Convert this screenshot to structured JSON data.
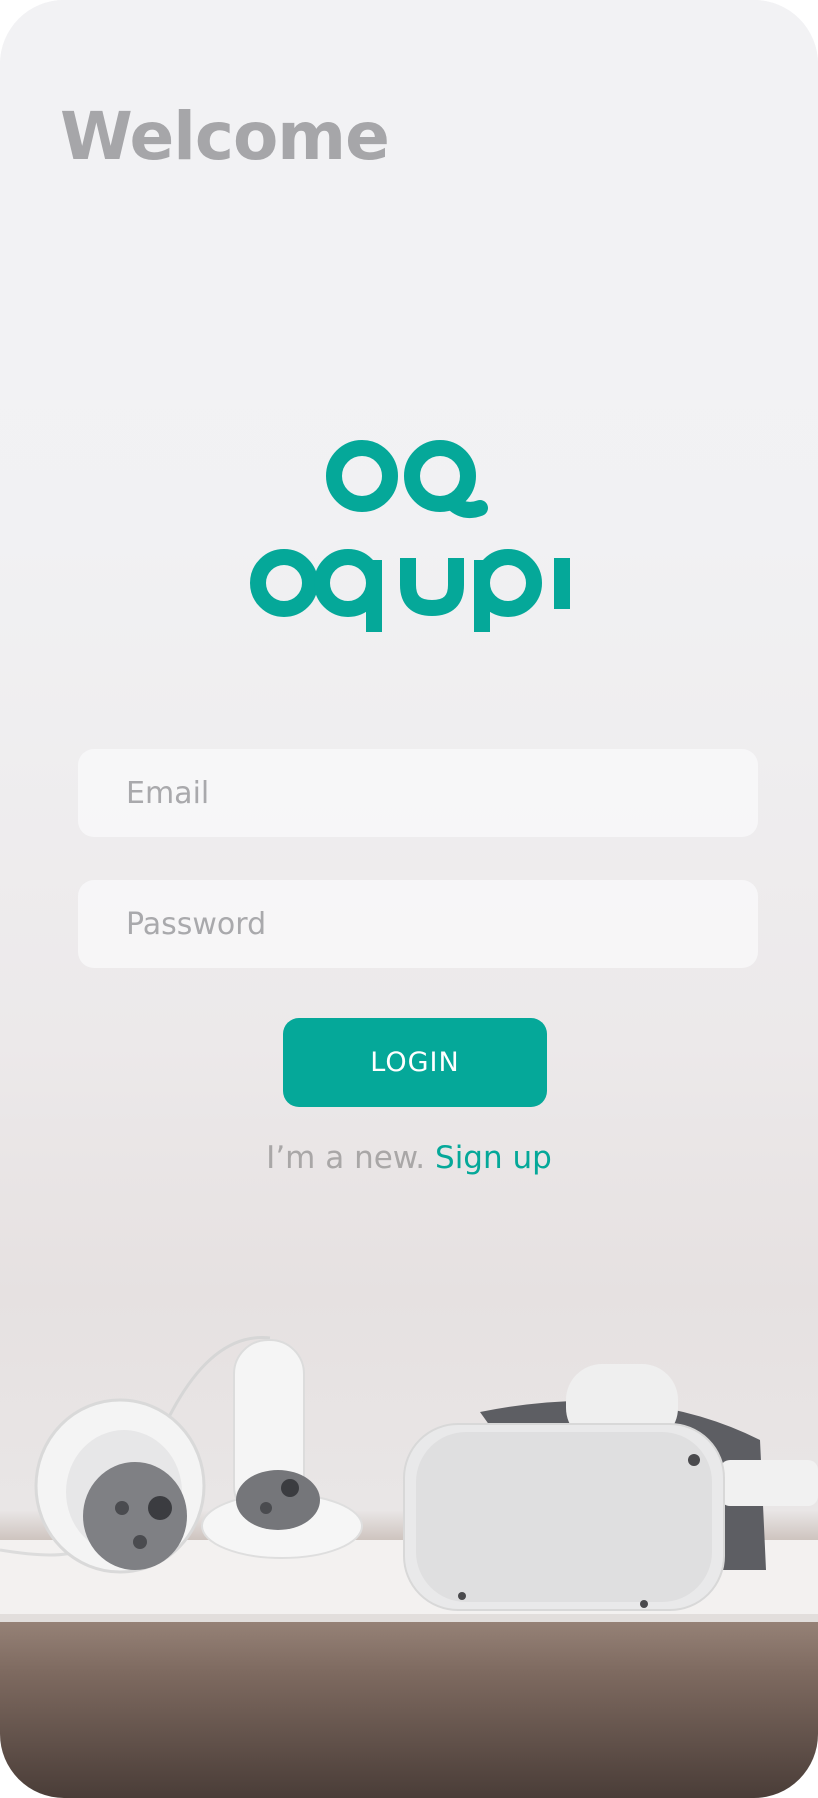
{
  "header": {
    "title": "Welcome"
  },
  "logo": {
    "wordmark": "oqupi",
    "mark": "OQ",
    "color": "#05A899"
  },
  "form": {
    "email": {
      "placeholder": "Email",
      "value": ""
    },
    "password": {
      "placeholder": "Password",
      "value": ""
    },
    "login_label": "LOGIN"
  },
  "signup": {
    "prompt": "I’m a new.",
    "link": "Sign up"
  },
  "background_image": {
    "subject": "vr-headset-and-controllers"
  },
  "colors": {
    "accent": "#05A899",
    "title": "#A6A6A9",
    "placeholder": "#A9A9AC"
  }
}
